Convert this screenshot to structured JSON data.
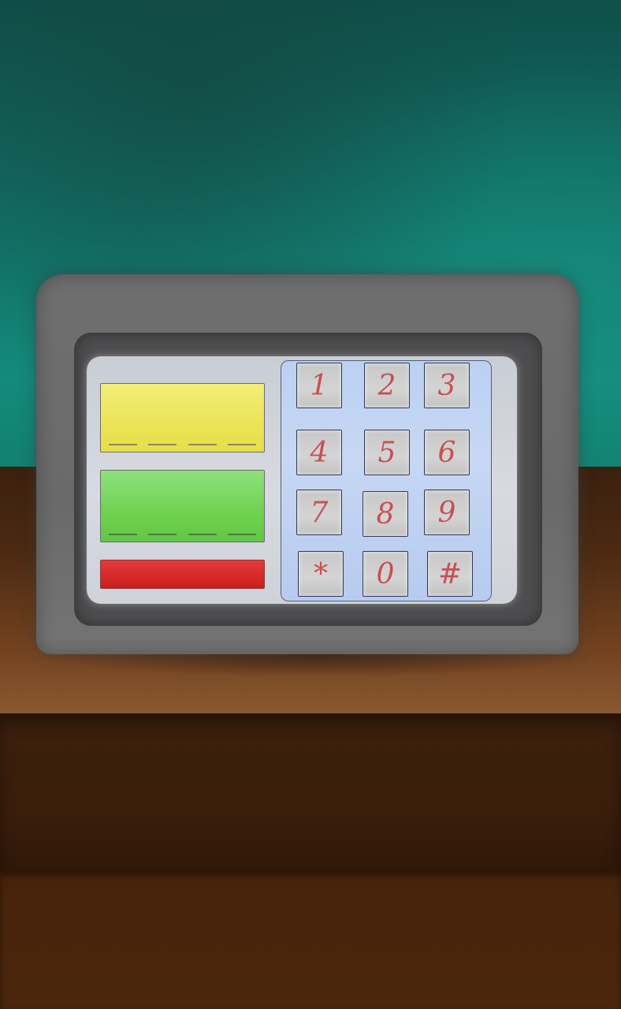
{
  "scene": "keypad-lock",
  "colors": {
    "wall": "#117066",
    "table": "#4c2a12",
    "device_body": "#6f6f70",
    "display_top": "#ebe456",
    "display_middle": "#6fd24f",
    "display_bottom": "#c81e1e",
    "keypad": "#c7d7f4",
    "key_text": "#c85050"
  },
  "keypad": {
    "keys": [
      {
        "label": "1"
      },
      {
        "label": "2"
      },
      {
        "label": "3"
      },
      {
        "label": "4"
      },
      {
        "label": "5"
      },
      {
        "label": "6"
      },
      {
        "label": "7"
      },
      {
        "label": "8"
      },
      {
        "label": "9"
      },
      {
        "label": "*"
      },
      {
        "label": "0"
      },
      {
        "label": "#"
      }
    ]
  }
}
